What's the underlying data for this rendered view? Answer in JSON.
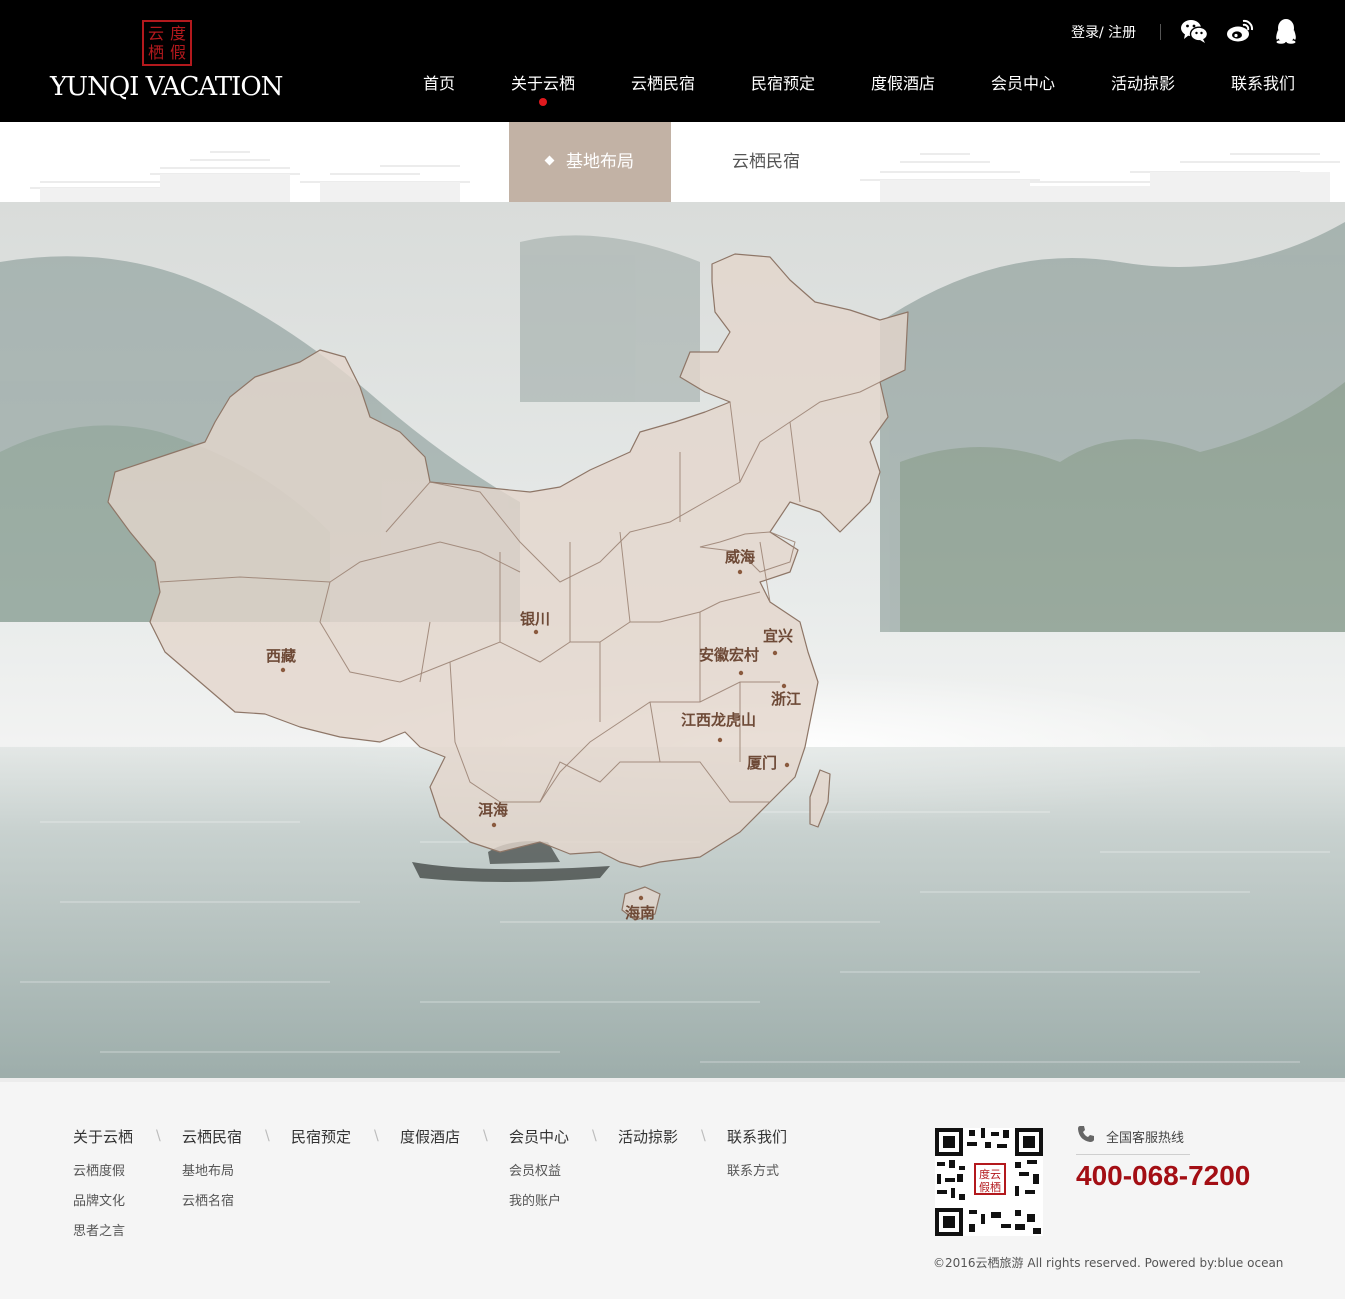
{
  "brand": {
    "seal_chars": [
      "云",
      "度",
      "栖",
      "假"
    ],
    "name": "YUNQI VACATION"
  },
  "header": {
    "login": "登录",
    "slash": "/",
    "register": "注册",
    "social_icons": [
      "wechat-icon",
      "weibo-icon",
      "qq-icon"
    ],
    "nav": [
      "首页",
      "关于云栖",
      "云栖民宿",
      "民宿预定",
      "度假酒店",
      "会员中心",
      "活动掠影",
      "联系我们"
    ],
    "nav_active_index": 1
  },
  "subnav": {
    "tabs": [
      "基地布局",
      "云栖民宿"
    ],
    "active": "基地布局"
  },
  "map": {
    "locations": [
      "威海",
      "银川",
      "宜兴",
      "西藏",
      "安徽宏村",
      "浙江",
      "江西龙虎山",
      "厦门",
      "洱海",
      "海南"
    ]
  },
  "footer": {
    "columns": [
      {
        "title": "关于云栖",
        "links": [
          "云栖度假",
          "品牌文化",
          "思者之言"
        ]
      },
      {
        "title": "云栖民宿",
        "links": [
          "基地布局",
          "云栖名宿"
        ]
      },
      {
        "title": "民宿预定",
        "links": []
      },
      {
        "title": "度假酒店",
        "links": []
      },
      {
        "title": "会员中心",
        "links": [
          "会员权益",
          "我的账户"
        ]
      },
      {
        "title": "活动掠影",
        "links": []
      },
      {
        "title": "联系我们",
        "links": [
          "联系方式"
        ]
      }
    ],
    "separator": "\\",
    "hotline_label": "全国客服热线",
    "hotline": "400-068-7200",
    "copyright": "©2016云栖旅游 All rights reserved. Powered by:blue ocean"
  },
  "colors": {
    "header_bg": "#000000",
    "accent_red": "#e0191e",
    "tab_active_bg": "#c2b2a5",
    "map_fill": "#e3d6cc",
    "label_color": "#6e4a37",
    "hotline_color": "#a30e14"
  }
}
